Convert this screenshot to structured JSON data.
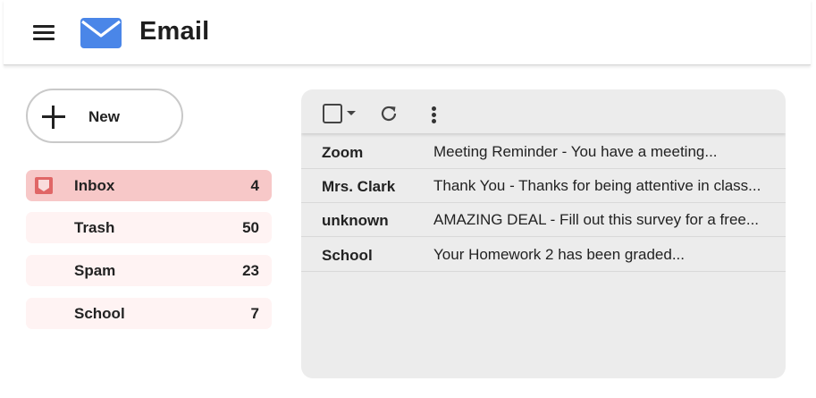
{
  "header": {
    "title": "Email",
    "logo_color": "#4a86e8",
    "icons": [
      "menu-icon",
      "mail-icon"
    ]
  },
  "compose": {
    "label": "New",
    "icon": "plus-icon"
  },
  "folders": [
    {
      "label": "Inbox",
      "count": "4",
      "active": true,
      "icon": "inbox-icon",
      "icon_color": "#e06666"
    },
    {
      "label": "Trash",
      "count": "50",
      "active": false
    },
    {
      "label": "Spam",
      "count": "23",
      "active": false
    },
    {
      "label": "School",
      "count": "7",
      "active": false
    }
  ],
  "toolbar": {
    "icons": [
      "checkbox",
      "chevron-down-icon",
      "refresh-icon",
      "more-vertical-icon"
    ]
  },
  "emails": [
    {
      "sender": "Zoom",
      "subject": "Meeting Reminder - You have a meeting..."
    },
    {
      "sender": "Mrs. Clark",
      "subject": "Thank You - Thanks for being attentive in class..."
    },
    {
      "sender": "unknown",
      "subject": "AMAZING DEAL - Fill out this survey for a free..."
    },
    {
      "sender": "School",
      "subject": "Your Homework 2 has been graded..."
    }
  ],
  "colors": {
    "active_folder_bg": "#f7c8c8",
    "folder_bg": "#fff3f3",
    "panel_bg": "#ececec"
  }
}
